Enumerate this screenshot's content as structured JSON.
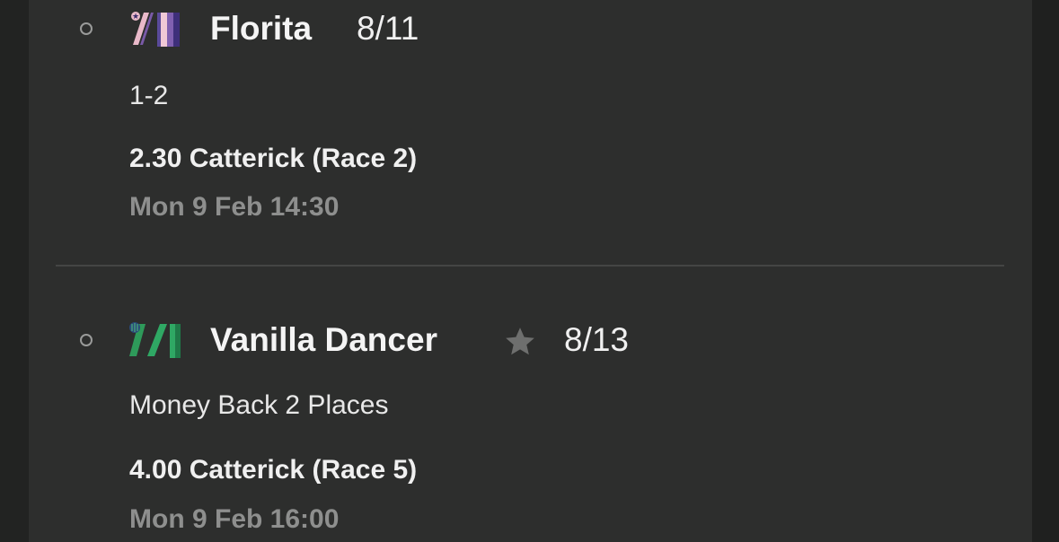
{
  "selections": [
    {
      "runner": "Florita",
      "odds": "8/11",
      "market": "1-2",
      "race": "2.30 Catterick (Race 2)",
      "datetime": "Mon 9 Feb 14:30",
      "silks_icon": "silks-pink-purple-stripes-icon",
      "favourite": false
    },
    {
      "runner": "Vanilla Dancer",
      "odds": "8/13",
      "market": "Money Back 2 Places",
      "race": "4.00 Catterick (Race 5)",
      "datetime": "Mon 9 Feb 16:00",
      "silks_icon": "silks-green-blue-icon",
      "favourite": true
    }
  ],
  "colors": {
    "background": "#2d2e2d",
    "muted_text": "#8e8f8e",
    "divider": "#444544",
    "star": "#6e6f6e"
  }
}
